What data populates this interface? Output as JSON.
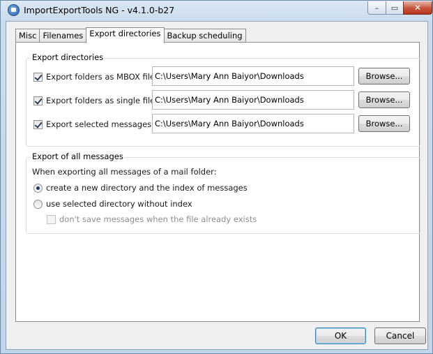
{
  "window": {
    "title": "ImportExportTools NG - v4.1.0-b27",
    "controls": {
      "minimize": "–",
      "maximize": "▭",
      "close": "✕"
    }
  },
  "tabs": [
    {
      "label": "Misc",
      "active": false
    },
    {
      "label": "Filenames",
      "active": false
    },
    {
      "label": "Export directories",
      "active": true
    },
    {
      "label": "Backup scheduling",
      "active": false
    }
  ],
  "export_directories": {
    "title": "Export directories",
    "rows": [
      {
        "label": "Export folders as MBOX file:",
        "checked": true,
        "path": "C:\\Users\\Mary Ann Baiyor\\Downloads",
        "button": "Browse..."
      },
      {
        "label": "Export folders as single files:",
        "checked": true,
        "path": "C:\\Users\\Mary Ann Baiyor\\Downloads",
        "button": "Browse..."
      },
      {
        "label": "Export selected messages:",
        "checked": true,
        "path": "C:\\Users\\Mary Ann Baiyor\\Downloads",
        "button": "Browse..."
      }
    ]
  },
  "export_all": {
    "title": "Export of all messages",
    "description": "When exporting all messages of a mail folder:",
    "option_new_dir": "create a new directory and the index of messages",
    "option_selected_dir": "use selected directory without index",
    "option_skip_existing": "don't save messages when the file already exists",
    "selected_option": "create a new directory and the index of messages"
  },
  "dialog_buttons": {
    "ok": "OK",
    "cancel": "Cancel"
  }
}
